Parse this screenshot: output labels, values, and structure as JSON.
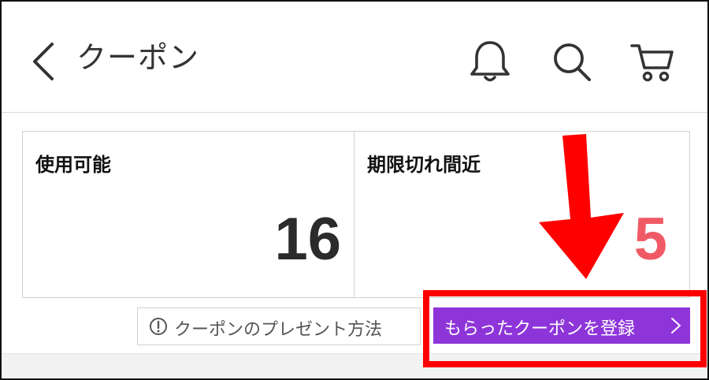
{
  "header": {
    "title": "クーポン",
    "icons": [
      "back-chevron-icon",
      "bell-icon",
      "search-icon",
      "cart-icon"
    ]
  },
  "cards": {
    "available": {
      "label": "使用可能",
      "value": "16"
    },
    "expiring": {
      "label": "期限切れ間近",
      "value": "5"
    }
  },
  "actions": {
    "howto_label": "クーポンのプレゼント方法",
    "register_label": "もらったクーポンを登録"
  },
  "colors": {
    "register_bg": "#8e35d9",
    "expiring_value": "#f05a66",
    "annotation": "#ff0000"
  }
}
